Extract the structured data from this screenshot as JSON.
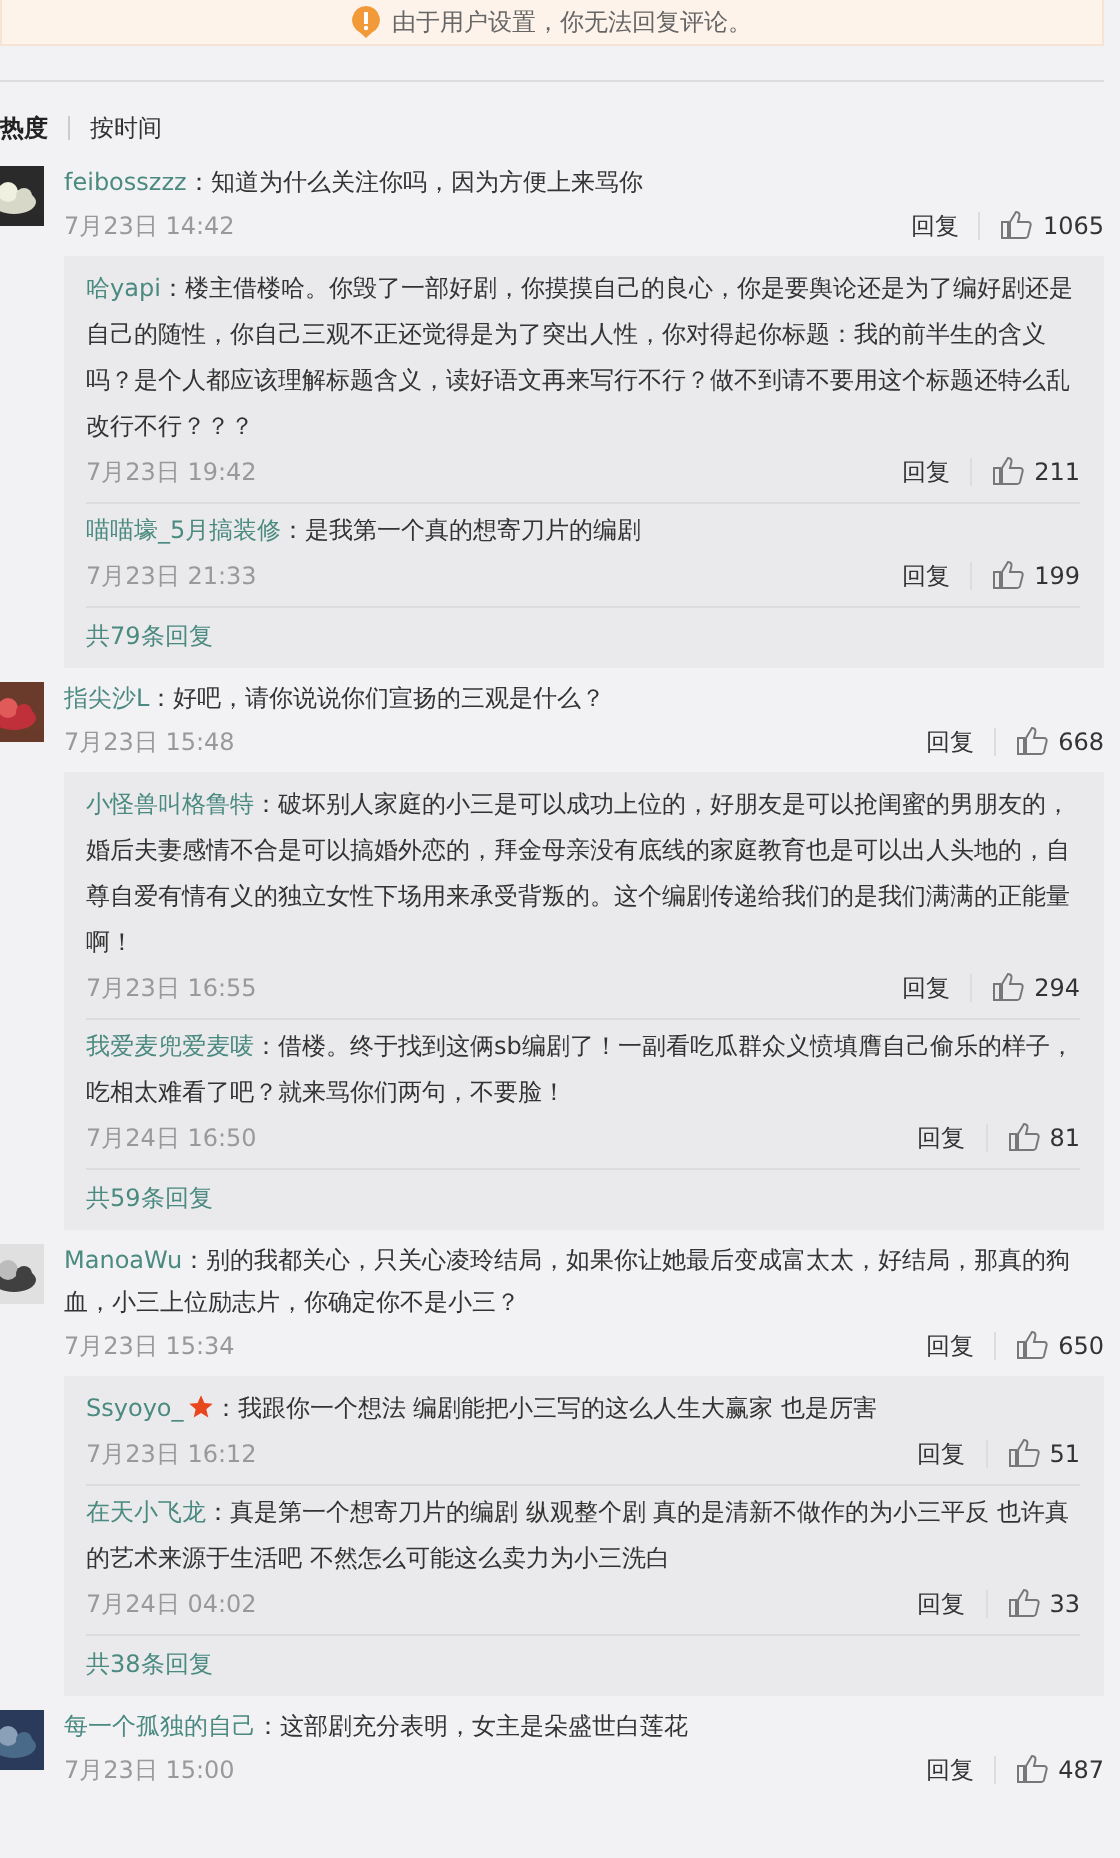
{
  "notice": {
    "text": "由于用户设置，你无法回复评论。"
  },
  "sort_tabs": [
    {
      "label": "热度",
      "selected": true
    },
    {
      "label": "按时间",
      "selected": false
    }
  ],
  "comments": [
    {
      "user": "feibosszzz",
      "text": "：知道为什么关注你吗，因为方便上来骂你",
      "date": "7月23日 14:42",
      "reply": "回复",
      "likes": "1065",
      "replies": [
        {
          "user": "哈yapi",
          "star_badge": false,
          "text": "：楼主借楼哈。你毁了一部好剧，你摸摸自己的良心，你是要舆论还是为了编好剧还是自己的随性，你自己三观不正还觉得是为了突出人性，你对得起你标题：我的前半生的含义吗？是个人都应该理解标题含义，读好语文再来写行不行？做不到请不要用这个标题还特么乱改行不行？？？",
          "date": "7月23日 19:42",
          "reply": "回复",
          "likes": "211"
        },
        {
          "user": "喵喵壕_5月搞装修",
          "star_badge": false,
          "text": "：是我第一个真的想寄刀片的编剧",
          "date": "7月23日 21:33",
          "reply": "回复",
          "likes": "199"
        }
      ],
      "more": "共79条回复"
    },
    {
      "user": "指尖沙L",
      "text": "：好吧，请你说说你们宣扬的三观是什么？",
      "date": "7月23日 15:48",
      "reply": "回复",
      "likes": "668",
      "replies": [
        {
          "user": "小怪兽叫格鲁特",
          "star_badge": false,
          "text": "：破坏别人家庭的小三是可以成功上位的，好朋友是可以抢闺蜜的男朋友的，婚后夫妻感情不合是可以搞婚外恋的，拜金母亲没有底线的家庭教育也是可以出人头地的，自尊自爱有情有义的独立女性下场用来承受背叛的。这个编剧传递给我们的是我们满满的正能量啊！",
          "date": "7月23日 16:55",
          "reply": "回复",
          "likes": "294"
        },
        {
          "user": "我爱麦兜爱麦唛",
          "star_badge": false,
          "text": "：借楼。终于找到这俩sb编剧了！一副看吃瓜群众义愤填膺自己偷乐的样子，吃相太难看了吧？就来骂你们两句，不要脸！",
          "date": "7月24日 16:50",
          "reply": "回复",
          "likes": "81"
        }
      ],
      "more": "共59条回复"
    },
    {
      "user": "ManoaWu",
      "text": "：别的我都关心，只关心凌玲结局，如果你让她最后变成富太太，好结局，那真的狗血，小三上位励志片，你确定你不是小三？",
      "date": "7月23日 15:34",
      "reply": "回复",
      "likes": "650",
      "replies": [
        {
          "user": "Ssyoyo_",
          "star_badge": true,
          "text": "：我跟你一个想法 编剧能把小三写的这么人生大赢家 也是厉害",
          "date": "7月23日 16:12",
          "reply": "回复",
          "likes": "51"
        },
        {
          "user": "在天小飞龙",
          "star_badge": false,
          "text": "：真是第一个想寄刀片的编剧 纵观整个剧 真的是清新不做作的为小三平反 也许真的艺术来源于生活吧 不然怎么可能这么卖力为小三洗白",
          "date": "7月24日 04:02",
          "reply": "回复",
          "likes": "33"
        }
      ],
      "more": "共38条回复"
    },
    {
      "user": "每一个孤独的自己",
      "text": "：这部剧充分表明，女主是朵盛世白莲花",
      "date": "7月23日 15:00",
      "reply": "回复",
      "likes": "487"
    }
  ]
}
